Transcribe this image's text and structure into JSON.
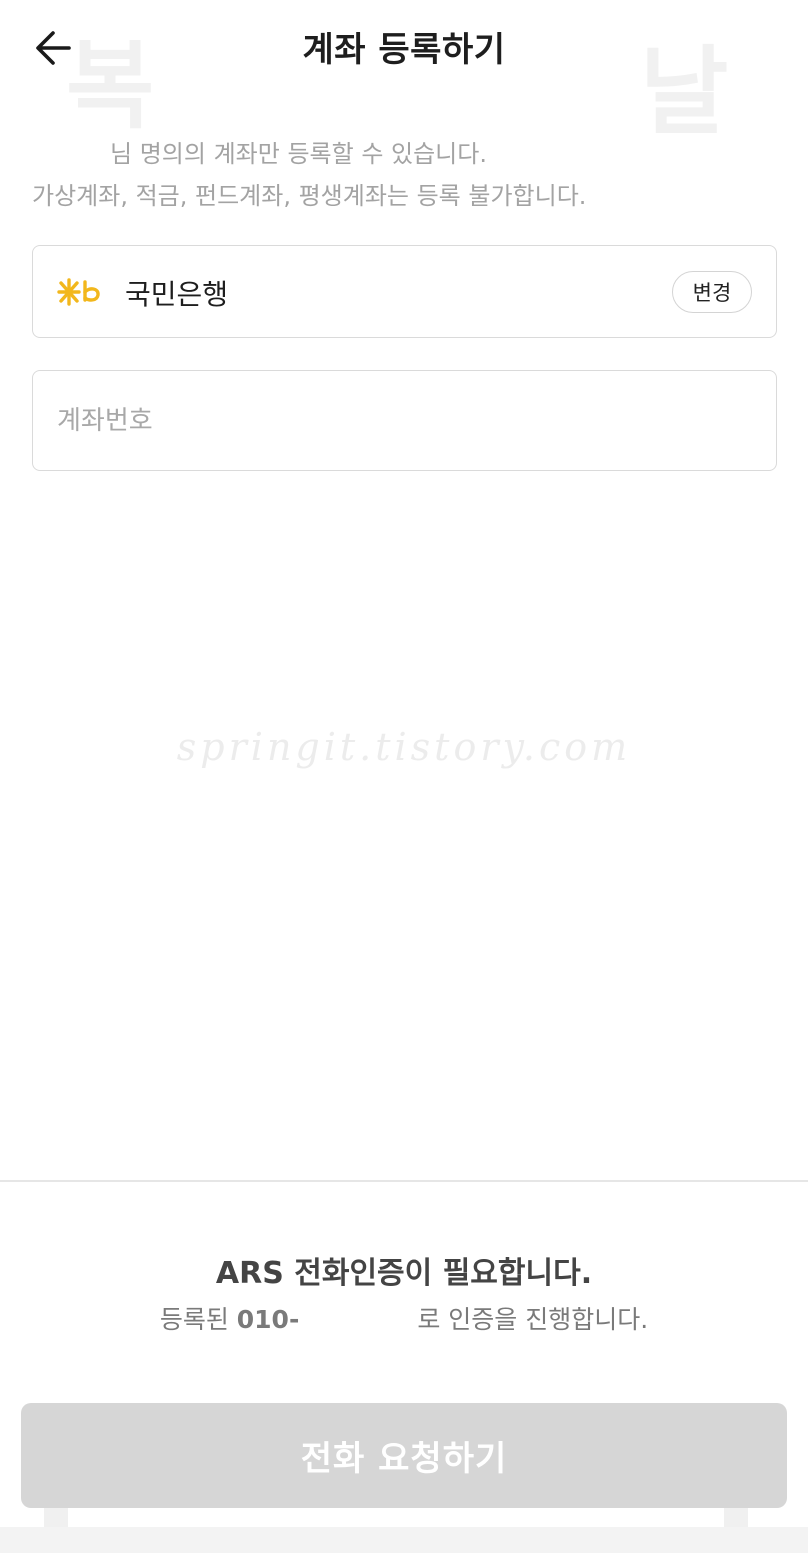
{
  "header": {
    "title": "계좌 등록하기",
    "back_icon": "arrow-left-icon"
  },
  "watermarks": {
    "left_char": "복",
    "right_char": "날",
    "center_text": "springit.tistory.com"
  },
  "notice": {
    "line1": "님 명의의 계좌만 등록할 수 있습니다.",
    "line2": "가상계좌, 적금, 펀드계좌, 평생계좌는 등록 불가합니다."
  },
  "bank": {
    "logo_icon": "kb-star-icon",
    "logo_color": "#f2b71c",
    "name": "국민은행",
    "change_label": "변경"
  },
  "account_field": {
    "placeholder": "계좌번호",
    "value": ""
  },
  "ars": {
    "title": "ARS 전화인증이 필요합니다.",
    "desc_prefix": "등록된 ",
    "phone_visible": "010-",
    "desc_suffix": "로 인증을 진행합니다."
  },
  "call_button": {
    "label": "전화 요청하기",
    "bg_color": "#d6d6d6"
  }
}
